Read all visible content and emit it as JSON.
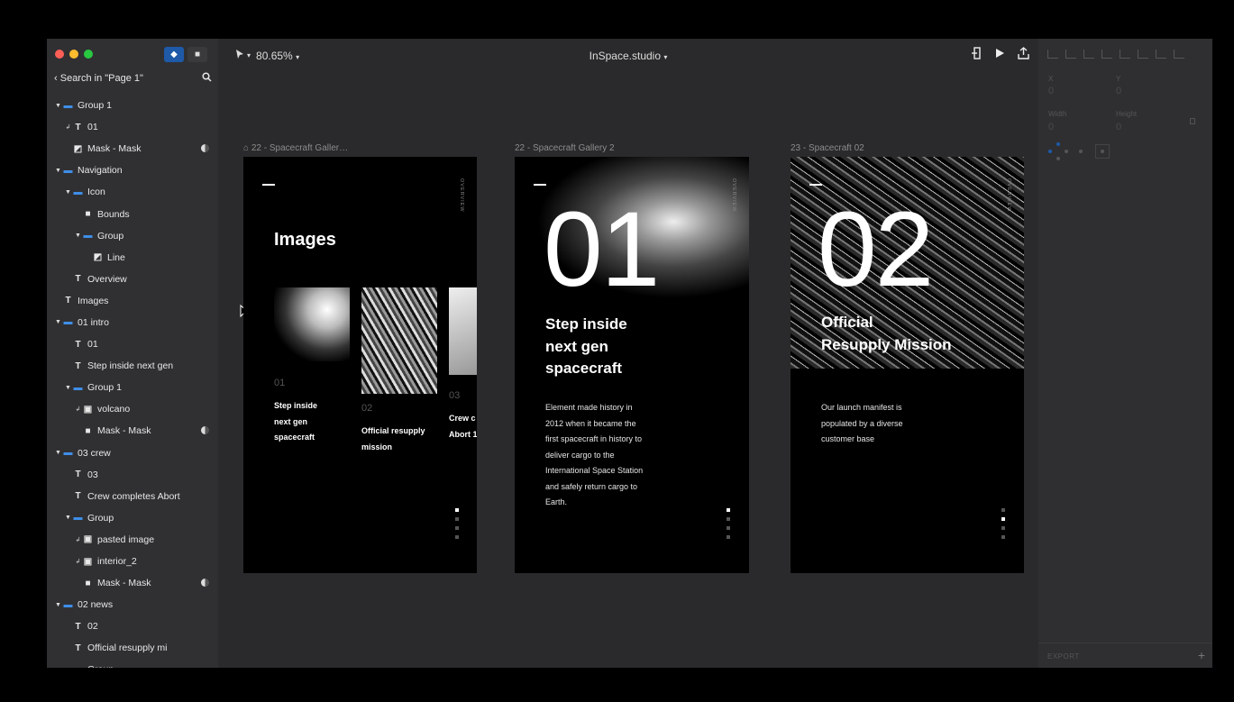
{
  "window": {
    "traffic_lights": [
      "#ff5f57",
      "#febc2e",
      "#28c840"
    ],
    "search_label": "Search in \"Page 1\""
  },
  "toolbar": {
    "zoom": "80.65%",
    "document_title": "InSpace.studio",
    "title_chevron": "▾",
    "zoom_chevron": "▾"
  },
  "layers": [
    {
      "level": 1,
      "icon": "folder-icon",
      "glyph": "▬",
      "label": "Group 1",
      "caret": true
    },
    {
      "level": 2,
      "icon": "text-icon",
      "glyph": "T",
      "label": "01",
      "clip": true
    },
    {
      "level": 2,
      "icon": "mask-icon",
      "glyph": "◩",
      "label": "Mask - Mask",
      "tail": true
    },
    {
      "level": 1,
      "icon": "folder-icon",
      "glyph": "▬",
      "label": "Navigation",
      "caret": true
    },
    {
      "level": 2,
      "icon": "folder-icon",
      "glyph": "▬",
      "label": "Icon",
      "caret": true
    },
    {
      "level": 3,
      "icon": "square-icon",
      "glyph": "■",
      "label": "Bounds"
    },
    {
      "level": 3,
      "icon": "folder-icon",
      "glyph": "▬",
      "label": "Group",
      "caret": true
    },
    {
      "level": 4,
      "icon": "line-icon",
      "glyph": "◩",
      "label": "Line"
    },
    {
      "level": 2,
      "icon": "text-icon",
      "glyph": "T",
      "label": "Overview"
    },
    {
      "level": 1,
      "icon": "text-icon",
      "glyph": "T",
      "label": "Images"
    },
    {
      "level": 1,
      "icon": "folder-icon",
      "glyph": "▬",
      "label": "01 intro",
      "caret": true
    },
    {
      "level": 2,
      "icon": "text-icon",
      "glyph": "T",
      "label": "01"
    },
    {
      "level": 2,
      "icon": "text-icon",
      "glyph": "T",
      "label": "Step inside next gen"
    },
    {
      "level": 2,
      "icon": "folder-icon",
      "glyph": "▬",
      "label": "Group 1",
      "caret": true
    },
    {
      "level": 3,
      "icon": "image-icon",
      "glyph": "▣",
      "label": "volcano",
      "clip": true
    },
    {
      "level": 3,
      "icon": "square-icon",
      "glyph": "■",
      "label": "Mask - Mask",
      "tail": true
    },
    {
      "level": 1,
      "icon": "folder-icon",
      "glyph": "▬",
      "label": "03 crew",
      "caret": true
    },
    {
      "level": 2,
      "icon": "text-icon",
      "glyph": "T",
      "label": "03"
    },
    {
      "level": 2,
      "icon": "text-icon",
      "glyph": "T",
      "label": "Crew completes Abort"
    },
    {
      "level": 2,
      "icon": "folder-icon",
      "glyph": "▬",
      "label": "Group",
      "caret": true
    },
    {
      "level": 3,
      "icon": "image-icon",
      "glyph": "▣",
      "label": "pasted image",
      "clip": true
    },
    {
      "level": 3,
      "icon": "image-icon",
      "glyph": "▣",
      "label": "interior_2",
      "clip": true
    },
    {
      "level": 3,
      "icon": "square-icon",
      "glyph": "■",
      "label": "Mask - Mask",
      "tail": true
    },
    {
      "level": 1,
      "icon": "folder-icon",
      "glyph": "▬",
      "label": "02 news",
      "caret": true
    },
    {
      "level": 2,
      "icon": "text-icon",
      "glyph": "T",
      "label": "02"
    },
    {
      "level": 2,
      "icon": "text-icon",
      "glyph": "T",
      "label": "Official resupply mi"
    },
    {
      "level": 2,
      "icon": "folder-icon",
      "glyph": "▬",
      "label": "Group",
      "caret": true
    }
  ],
  "inspector": {
    "x_label": "X",
    "x_value": "0",
    "y_label": "Y",
    "y_value": "0",
    "width_label": "Width",
    "width_value": "0",
    "height_label": "Height",
    "height_value": "0",
    "export_label": "EXPORT",
    "add_label": "+"
  },
  "artboards": {
    "a1": {
      "label": "22 - Spacecraft Galler…",
      "vertical": "OVERVIEW",
      "heading": "Images",
      "cards": [
        {
          "num": "01",
          "title_lines": [
            "Step inside",
            "next gen",
            "spacecraft"
          ]
        },
        {
          "num": "02",
          "title_lines": [
            "Official resupply",
            "mission"
          ]
        },
        {
          "num": "03",
          "title_lines": [
            "Crew c",
            "Abort 1"
          ]
        }
      ]
    },
    "a2": {
      "label": "22 - Spacecraft Gallery 2",
      "vertical": "OVERVIEW",
      "big_number": "01",
      "title_lines": [
        "Step inside",
        "next gen",
        "spacecraft"
      ],
      "body_lines": [
        "Element made history in",
        "2012 when it became the",
        "first spacecraft in history to",
        "deliver cargo to the",
        "International Space Station",
        "and safely return cargo to",
        "Earth."
      ]
    },
    "a3": {
      "label": "23 - Spacecraft 02",
      "vertical": "OVERVIEW",
      "big_number": "02",
      "title_lines": [
        "Official",
        "Resupply Mission"
      ],
      "body_lines": [
        "Our launch manifest is",
        "populated by a diverse",
        "customer base"
      ]
    }
  }
}
